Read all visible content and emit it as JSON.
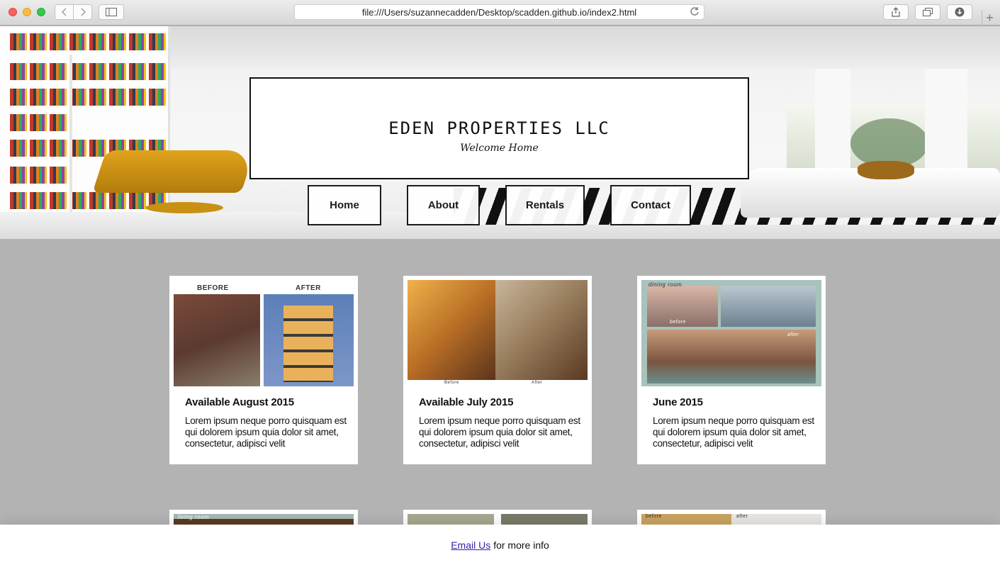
{
  "browser": {
    "url": "file:///Users/suzannecadden/Desktop/scadden.github.io/index2.html"
  },
  "header": {
    "title": "EDEN PROPERTIES LLC",
    "tagline": "Welcome Home"
  },
  "nav": {
    "items": [
      {
        "label": "Home"
      },
      {
        "label": "About"
      },
      {
        "label": "Rentals"
      },
      {
        "label": "Contact"
      }
    ]
  },
  "cards": [
    {
      "title": "Available August 2015",
      "text": "Lorem ipsum neque porro quisquam est qui dolorem ipsum quia dolor sit amet, consectetur, adipisci velit",
      "image_before_label": "BEFORE",
      "image_after_label": "AFTER"
    },
    {
      "title": "Available July 2015",
      "text": "Lorem ipsum neque porro quisquam est qui dolorem ipsum quia dolor sit amet, consectetur, adipisci velit",
      "image_before_label": "Before",
      "image_after_label": "After"
    },
    {
      "title": "June 2015",
      "text": "Lorem ipsum neque porro quisquam est qui dolorem ipsum quia dolor sit amet, consectetur, adipisci velit",
      "image_top_label": "dining room",
      "image_before_label": "before",
      "image_after_label": "after"
    }
  ],
  "partial_cards": [
    {
      "image_label": "living room"
    },
    {
      "image_label": ""
    },
    {
      "image_before_label": "before",
      "image_after_label": "after"
    }
  ],
  "footer": {
    "link_label": "Email Us",
    "text": "for more info"
  }
}
